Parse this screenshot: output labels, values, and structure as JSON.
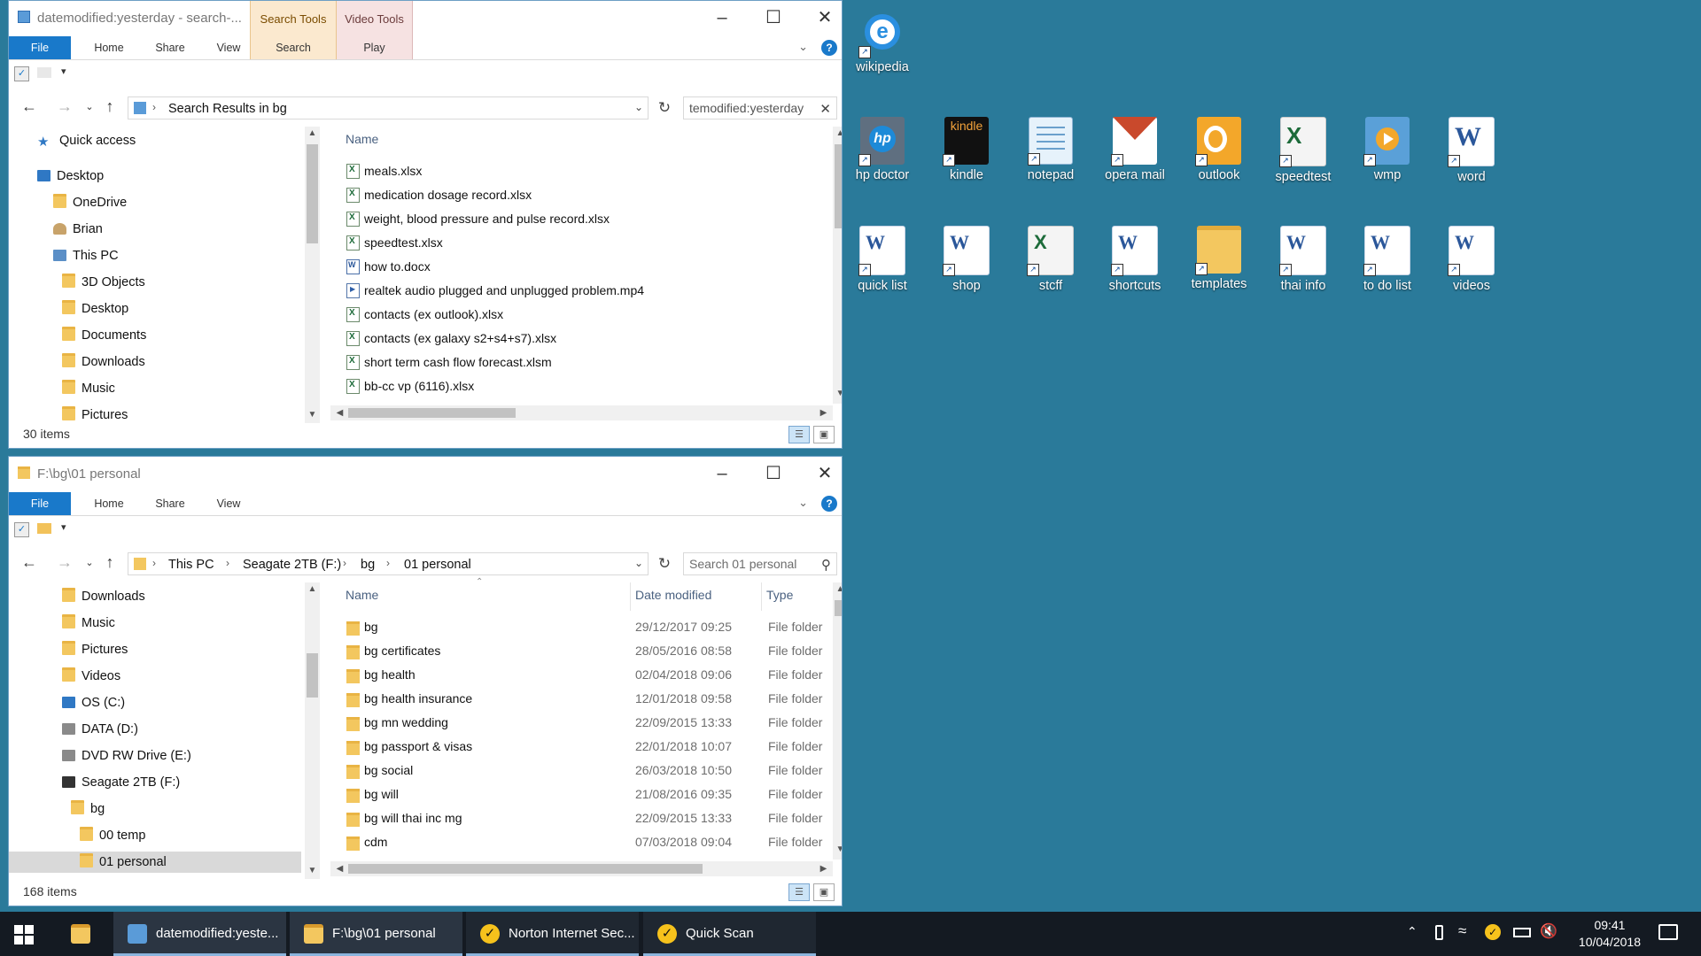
{
  "window_top": {
    "title": "datemodified:yesterday - search-...",
    "context_tabs": [
      {
        "label": "Search Tools"
      },
      {
        "label": "Video Tools"
      }
    ],
    "ribbon_tabs": {
      "file": "File",
      "home": "Home",
      "share": "Share",
      "view": "View",
      "search": "Search",
      "play": "Play"
    },
    "address": {
      "crumb": "Search Results in bg"
    },
    "search_value": "temodified:yesterday",
    "nav_items": [
      {
        "label": "Quick access"
      },
      {
        "label": "Desktop"
      },
      {
        "label": "OneDrive"
      },
      {
        "label": "Brian"
      },
      {
        "label": "This PC"
      },
      {
        "label": "3D Objects"
      },
      {
        "label": "Desktop"
      },
      {
        "label": "Documents"
      },
      {
        "label": "Downloads"
      },
      {
        "label": "Music"
      },
      {
        "label": "Pictures"
      }
    ],
    "columns": {
      "name": "Name"
    },
    "files": [
      {
        "name": "meals.xlsx",
        "kind": "xl"
      },
      {
        "name": "medication dosage record.xlsx",
        "kind": "xl"
      },
      {
        "name": "weight, blood pressure and pulse record.xlsx",
        "kind": "xl"
      },
      {
        "name": "speedtest.xlsx",
        "kind": "xl"
      },
      {
        "name": "how to.docx",
        "kind": "wd"
      },
      {
        "name": "realtek audio plugged and unplugged problem.mp4",
        "kind": "mp"
      },
      {
        "name": "contacts (ex outlook).xlsx",
        "kind": "xl"
      },
      {
        "name": "contacts (ex galaxy s2+s4+s7).xlsx",
        "kind": "xl"
      },
      {
        "name": "short term cash flow forecast.xlsm",
        "kind": "xl"
      },
      {
        "name": "bb-cc vp (6116).xlsx",
        "kind": "xl"
      }
    ],
    "status": "30 items"
  },
  "window_bottom": {
    "title": "F:\\bg\\01 personal",
    "ribbon_tabs": {
      "file": "File",
      "home": "Home",
      "share": "Share",
      "view": "View"
    },
    "address": {
      "crumbs": [
        "This PC",
        "Seagate 2TB (F:)",
        "bg",
        "01 personal"
      ]
    },
    "search_placeholder": "Search 01 personal",
    "nav_items": [
      {
        "label": "Downloads"
      },
      {
        "label": "Music"
      },
      {
        "label": "Pictures"
      },
      {
        "label": "Videos"
      },
      {
        "label": "OS (C:)"
      },
      {
        "label": "DATA (D:)"
      },
      {
        "label": "DVD RW Drive (E:)"
      },
      {
        "label": "Seagate 2TB (F:)"
      },
      {
        "label": "bg"
      },
      {
        "label": "00 temp"
      },
      {
        "label": "01 personal"
      }
    ],
    "columns": {
      "name": "Name",
      "date": "Date modified",
      "type": "Type"
    },
    "files": [
      {
        "name": "bg",
        "date": "29/12/2017 09:25",
        "type": "File folder"
      },
      {
        "name": "bg certificates",
        "date": "28/05/2016 08:58",
        "type": "File folder"
      },
      {
        "name": "bg health",
        "date": "02/04/2018 09:06",
        "type": "File folder"
      },
      {
        "name": "bg health insurance",
        "date": "12/01/2018 09:58",
        "type": "File folder"
      },
      {
        "name": "bg mn wedding",
        "date": "22/09/2015 13:33",
        "type": "File folder"
      },
      {
        "name": "bg passport & visas",
        "date": "22/01/2018 10:07",
        "type": "File folder"
      },
      {
        "name": "bg social",
        "date": "26/03/2018 10:50",
        "type": "File folder"
      },
      {
        "name": "bg will",
        "date": "21/08/2016 09:35",
        "type": "File folder"
      },
      {
        "name": "bg will thai inc mg",
        "date": "22/09/2015 13:33",
        "type": "File folder"
      },
      {
        "name": "cdm",
        "date": "07/03/2018 09:04",
        "type": "File folder"
      }
    ],
    "status": "168 items"
  },
  "desktop_icons": [
    {
      "label": "wikipedia",
      "icon": "ie-icon"
    },
    {
      "label": "hp doctor",
      "icon": "hp-icon"
    },
    {
      "label": "kindle",
      "icon": "kindle-icon",
      "badge": "kindle"
    },
    {
      "label": "notepad",
      "icon": "notepad-icon"
    },
    {
      "label": "opera  mail",
      "icon": "mail-icon"
    },
    {
      "label": "outlook",
      "icon": "outlook-icon"
    },
    {
      "label": "speedtest",
      "icon": "excel-icon"
    },
    {
      "label": "wmp",
      "icon": "media-player-icon"
    },
    {
      "label": "word",
      "icon": "word-icon"
    },
    {
      "label": "quick list",
      "icon": "word-doc-icon"
    },
    {
      "label": "shop",
      "icon": "word-doc-icon"
    },
    {
      "label": "stcff",
      "icon": "excel-doc-icon"
    },
    {
      "label": "shortcuts",
      "icon": "word-doc-icon"
    },
    {
      "label": "templates",
      "icon": "folder-doc-icon"
    },
    {
      "label": "thai info",
      "icon": "word-doc-icon"
    },
    {
      "label": "to do list",
      "icon": "word-doc-icon"
    },
    {
      "label": "videos",
      "icon": "word-doc-icon"
    }
  ],
  "taskbar": {
    "apps": [
      {
        "label": "datemodified:yeste..."
      },
      {
        "label": "F:\\bg\\01 personal"
      },
      {
        "label": "Norton Internet Sec..."
      },
      {
        "label": "Quick Scan"
      }
    ],
    "time": "09:41",
    "date": "10/04/2018"
  },
  "colors": {
    "desktop": "#2a7a9a",
    "accent": "#1979ca",
    "taskbar": "#141a22"
  }
}
